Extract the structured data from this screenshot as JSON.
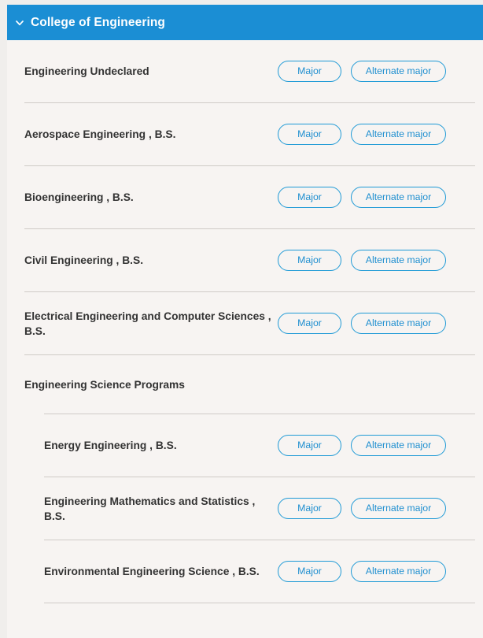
{
  "colors": {
    "header_blue": "#1b8ed4",
    "accent_blue": "#1f8fd0",
    "card_background": "#f7f4f2",
    "page_background": "#f0eeec",
    "text_dark": "#333333",
    "divider": "#cfcbc7"
  },
  "header": {
    "title": "College of Engineering",
    "expand_icon": "chevron-down-icon",
    "expanded": true
  },
  "buttons": {
    "major_label": "Major",
    "alternate_major_label": "Alternate major"
  },
  "list": [
    {
      "type": "program",
      "level": 0,
      "name": "Engineering Undeclared",
      "has_actions": true
    },
    {
      "type": "program",
      "level": 0,
      "name": "Aerospace Engineering , B.S.",
      "has_actions": true
    },
    {
      "type": "program",
      "level": 0,
      "name": "Bioengineering , B.S.",
      "has_actions": true
    },
    {
      "type": "program",
      "level": 0,
      "name": "Civil Engineering , B.S.",
      "has_actions": true
    },
    {
      "type": "program",
      "level": 0,
      "name": "Electrical Engineering and Computer Sciences , B.S.",
      "has_actions": true
    },
    {
      "type": "group",
      "level": 0,
      "name": "Engineering Science Programs",
      "has_actions": false
    },
    {
      "type": "program",
      "level": 1,
      "name": "Energy Engineering , B.S.",
      "has_actions": true
    },
    {
      "type": "program",
      "level": 1,
      "name": "Engineering Mathematics and Statistics , B.S.",
      "has_actions": true
    },
    {
      "type": "program",
      "level": 1,
      "name": "Environmental Engineering Science , B.S.",
      "has_actions": true
    }
  ]
}
